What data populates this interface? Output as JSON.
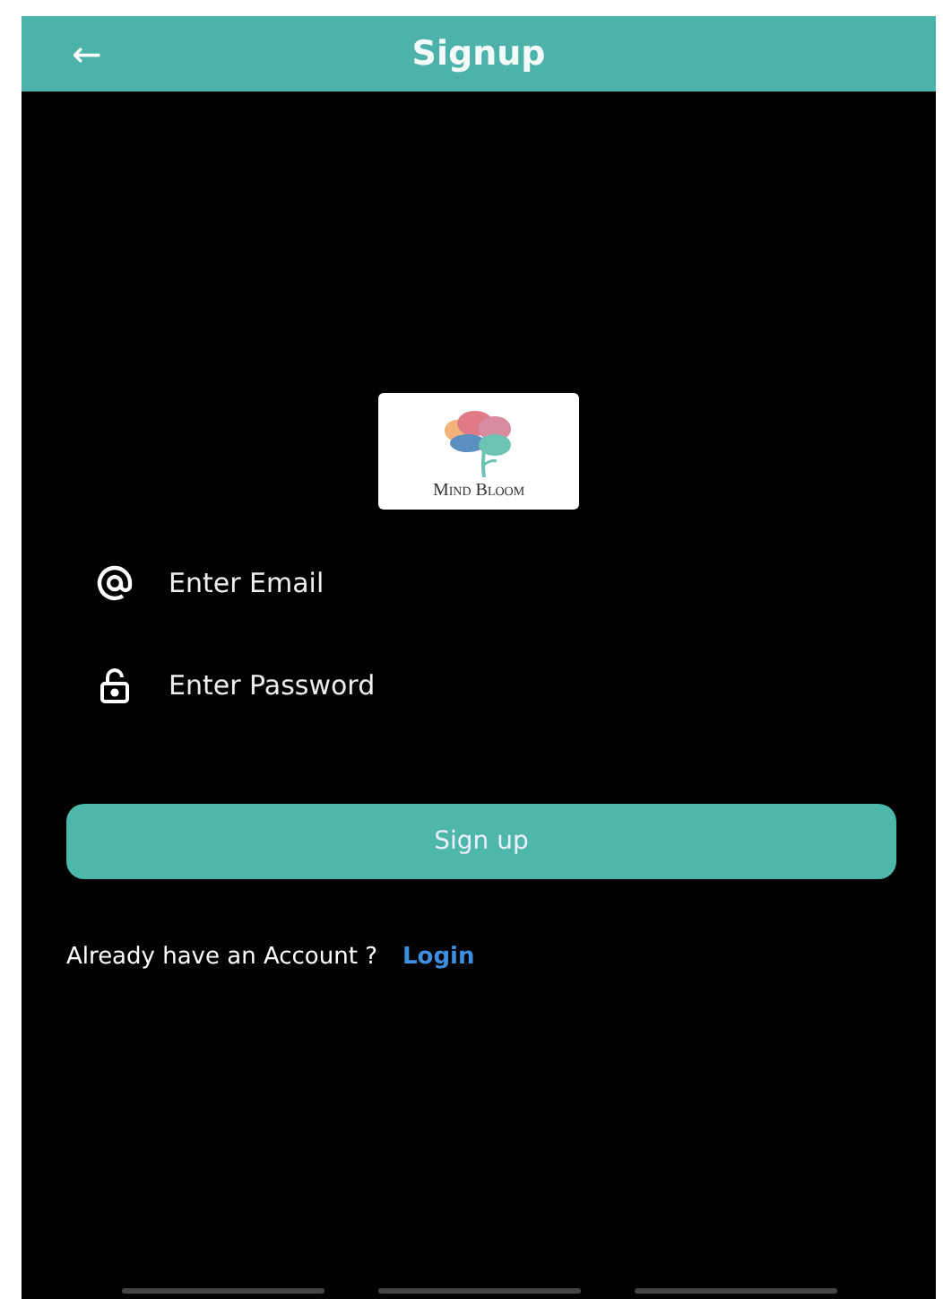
{
  "header": {
    "back_icon": "←",
    "title": "Signup"
  },
  "logo": {
    "text": "Mind Bloom"
  },
  "fields": [
    {
      "kind": "email",
      "placeholder": "Enter Email"
    },
    {
      "kind": "password",
      "placeholder": "Enter Password"
    }
  ],
  "signup_button": "Sign up",
  "login_prompt": {
    "text": "Already have an Account ?",
    "link": "Login"
  }
}
